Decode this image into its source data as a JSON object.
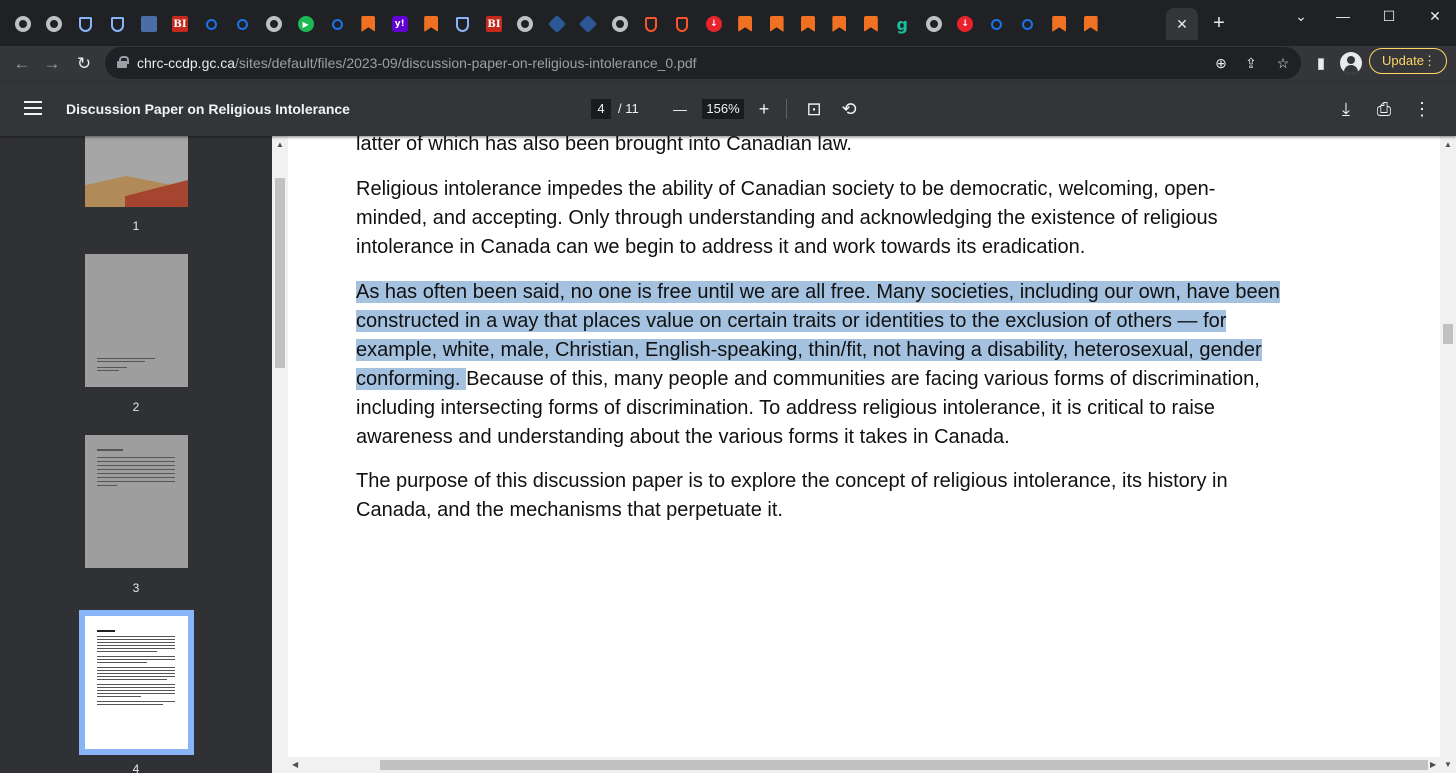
{
  "window": {
    "minimize": "—",
    "maximize": "☐",
    "close": "✕",
    "tabs_menu": "⌄"
  },
  "tabs": [
    {
      "icon": "globe-icon"
    },
    {
      "icon": "globe-icon"
    },
    {
      "icon": "shield-icon"
    },
    {
      "icon": "shield-icon"
    },
    {
      "icon": "dark-icon"
    },
    {
      "icon": "bi-icon",
      "text": "BI"
    },
    {
      "icon": "search-icon"
    },
    {
      "icon": "search-icon"
    },
    {
      "icon": "globe-icon"
    },
    {
      "icon": "play-icon",
      "text": "▶"
    },
    {
      "icon": "search-icon"
    },
    {
      "icon": "bookmark-icon"
    },
    {
      "icon": "yahoo-icon",
      "text": "y!"
    },
    {
      "icon": "bookmark-icon"
    },
    {
      "icon": "shield-icon"
    },
    {
      "icon": "bi-icon",
      "text": "BI"
    },
    {
      "icon": "globe-icon"
    },
    {
      "icon": "cube-icon"
    },
    {
      "icon": "cube-icon"
    },
    {
      "icon": "globe-icon"
    },
    {
      "icon": "brave-icon"
    },
    {
      "icon": "brave-icon"
    },
    {
      "icon": "red-icon",
      "text": "↓"
    },
    {
      "icon": "bookmark-icon"
    },
    {
      "icon": "bookmark-icon"
    },
    {
      "icon": "bookmark-icon"
    },
    {
      "icon": "bookmark-icon"
    },
    {
      "icon": "bookmark-icon"
    },
    {
      "icon": "g-icon",
      "text": "g"
    },
    {
      "icon": "globe-icon"
    },
    {
      "icon": "red-icon",
      "text": "↓"
    },
    {
      "icon": "search-icon"
    },
    {
      "icon": "search-icon"
    },
    {
      "icon": "bookmark-icon"
    },
    {
      "icon": "bookmark-icon"
    }
  ],
  "newtab": "+",
  "nav": {
    "back": "←",
    "forward": "→",
    "reload": "↻"
  },
  "address": {
    "host": "chrc-ccdp.gc.ca",
    "path": "/sites/default/files/2023-09/discussion-paper-on-religious-intolerance_0.pdf"
  },
  "toolbar": {
    "zoom_icon": "⊕",
    "share_icon": "⇪",
    "star_icon": "☆",
    "sidepanel_icon": "▮",
    "update_label": "Update",
    "menu": "⋮"
  },
  "pdf": {
    "title": "Discussion Paper on Religious Intolerance",
    "current_page": "4",
    "page_total": "/ 11",
    "zoom": "156%",
    "zoom_out": "—",
    "zoom_in": "+",
    "fit_icon": "⊡",
    "rotate_icon": "⟲",
    "download_icon": "⤓",
    "print_icon": "⎙",
    "more_icon": "⋮"
  },
  "thumbnails": [
    {
      "label": "1"
    },
    {
      "label": "2"
    },
    {
      "label": "3"
    },
    {
      "label": "4"
    }
  ],
  "content": {
    "p0": "latter of which has also been brought into Canadian law.",
    "p1_l1": "Religious intolerance impedes the ability of Canadian society to be democratic, welcoming, open-",
    "p1_l2": "minded, and accepting. Only through understanding and acknowledging the existence of religious",
    "p1_l3": "intolerance in Canada can we begin to address it and work towards its eradication.",
    "p2_l1": "As has often been said, no one is free until we are all free. Many societies, including our own, have been",
    "p2_l2": "constructed in a way that places value on certain traits or identities to the exclusion of others — for",
    "p2_l3": "example, white, male, Christian, English-speaking, thin/fit, not having a disability, heterosexual, gender",
    "p2_l4a": "conforming. ",
    "p2_l4b": "Because of this, many people and communities are facing various forms of discrimination,",
    "p2_l5": "including intersecting forms of discrimination. To address religious intolerance, it is critical to raise",
    "p2_l6": "awareness and understanding about the various forms it takes in Canada.",
    "p3_l1": "The purpose of this discussion paper is to explore the concept of religious intolerance, its history in",
    "p3_l2": "Canada, and the mechanisms that perpetuate it."
  }
}
